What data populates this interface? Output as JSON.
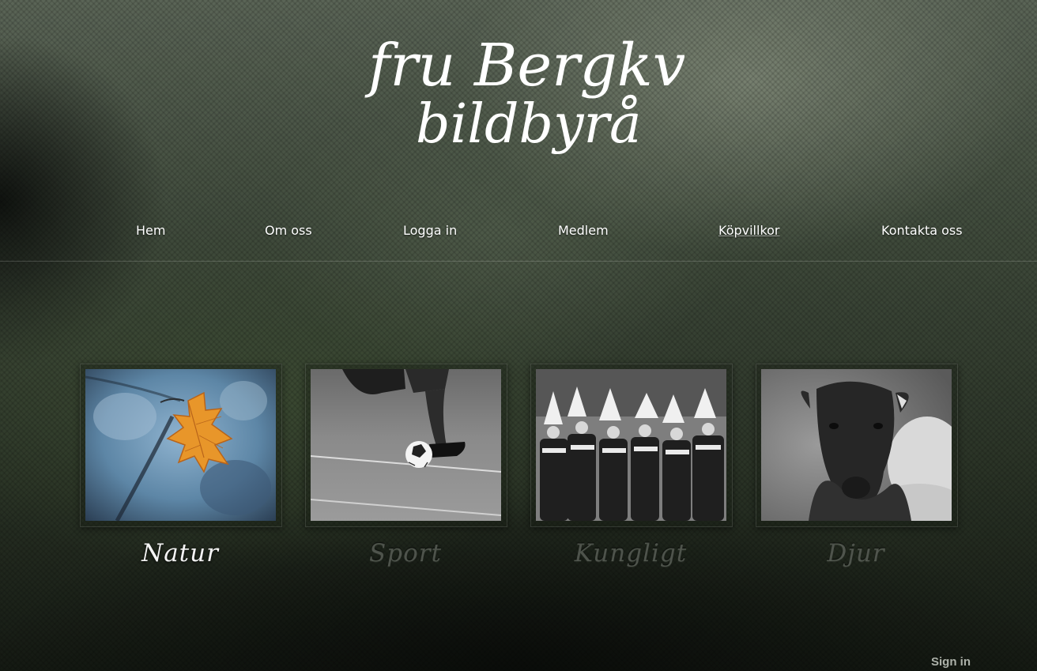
{
  "logo": {
    "line1": "fru Bergkvist",
    "line2": "bildbyrå"
  },
  "nav": {
    "items": [
      {
        "label": "Hem"
      },
      {
        "label": "Om oss"
      },
      {
        "label": "Logga in"
      },
      {
        "label": "Medlem"
      },
      {
        "label": "Köpvillkor"
      },
      {
        "label": "Kontakta oss"
      }
    ]
  },
  "gallery": {
    "categories": [
      {
        "label": "Natur",
        "photo": "orange autumn leaf on blue background"
      },
      {
        "label": "Sport",
        "photo": "football player kicking ball, black and white"
      },
      {
        "label": "Kungligt",
        "photo": "royal guards in plumed helmets, black and white"
      },
      {
        "label": "Djur",
        "photo": "black sheep portrait, black and white"
      }
    ]
  },
  "footer": {
    "signin_label": "Sign in"
  },
  "colors": {
    "text": "#ffffff",
    "leaf": "#e8962a",
    "natur_bg": "#5d86a6"
  }
}
